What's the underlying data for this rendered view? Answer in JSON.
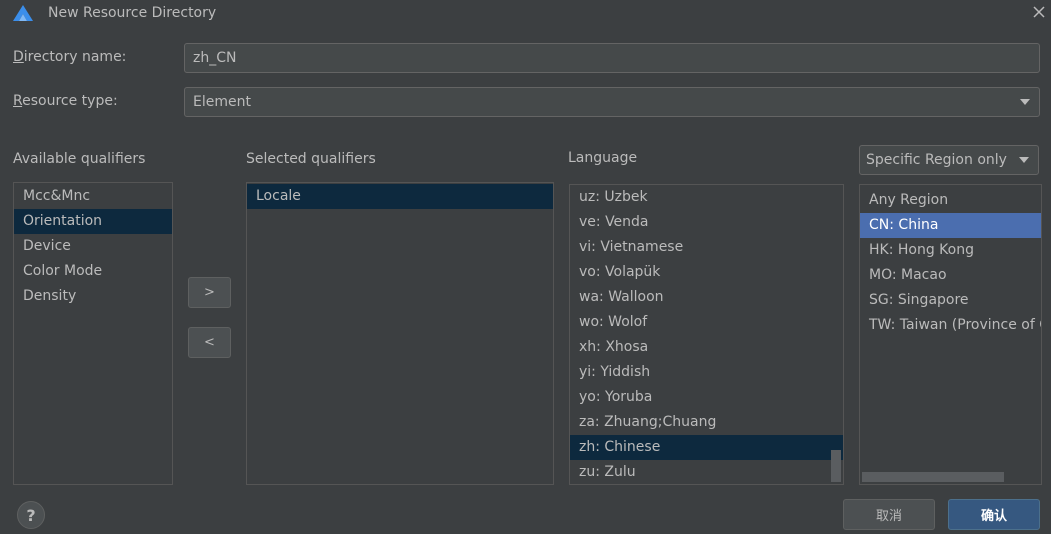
{
  "window": {
    "title": "New Resource Directory"
  },
  "form": {
    "directory_name_label": "Directory name:",
    "directory_name_value": "zh_CN",
    "resource_type_label": "Resource type:",
    "resource_type_value": "Element"
  },
  "available": {
    "header": "Available qualifiers",
    "items": [
      "Mcc&Mnc",
      "Orientation",
      "Device",
      "Color Mode",
      "Density"
    ],
    "selected_index": 1
  },
  "selected": {
    "header": "Selected qualifiers",
    "items": [
      "Locale"
    ]
  },
  "move_buttons": {
    "add": ">",
    "remove": "<"
  },
  "language": {
    "header": "Language",
    "items": [
      "uz: Uzbek",
      "ve: Venda",
      "vi: Vietnamese",
      "vo: Volapük",
      "wa: Walloon",
      "wo: Wolof",
      "xh: Xhosa",
      "yi: Yiddish",
      "yo: Yoruba",
      "za: Zhuang;Chuang",
      "zh: Chinese",
      "zu: Zulu"
    ],
    "selected_index": 10
  },
  "region": {
    "filter_value": "Specific Region only",
    "items": [
      "Any Region",
      "CN: China",
      "HK: Hong Kong",
      "MO: Macao",
      "SG: Singapore",
      "TW: Taiwan (Province of China)"
    ],
    "selected_index": 1
  },
  "footer": {
    "help": "?",
    "cancel": "取消",
    "ok": "确认"
  },
  "colors": {
    "background": "#3c3f41",
    "selection_dark": "#0d293e",
    "selection_blue": "#4b6eaf",
    "primary_button": "#365880"
  },
  "icons": {
    "app": "app-logo-icon",
    "close": "close-icon",
    "dropdown": "chevron-down-icon",
    "help": "help-icon"
  }
}
